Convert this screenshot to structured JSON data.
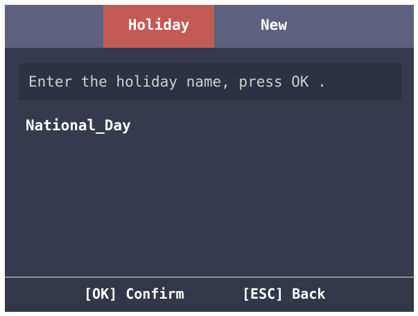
{
  "tabs": [
    {
      "label": "Holiday",
      "active": true
    },
    {
      "label": "New",
      "active": false
    }
  ],
  "prompt": "Enter the holiday name, press OK .",
  "input_value": "National_Day",
  "footer": {
    "confirm_label": "[OK] Confirm",
    "back_label": "[ESC] Back"
  },
  "colors": {
    "background": "#353a4e",
    "tab_bar": "#5e6080",
    "active_tab": "#c45a56",
    "prompt_box": "#2c3143",
    "text": "#ffffff"
  }
}
